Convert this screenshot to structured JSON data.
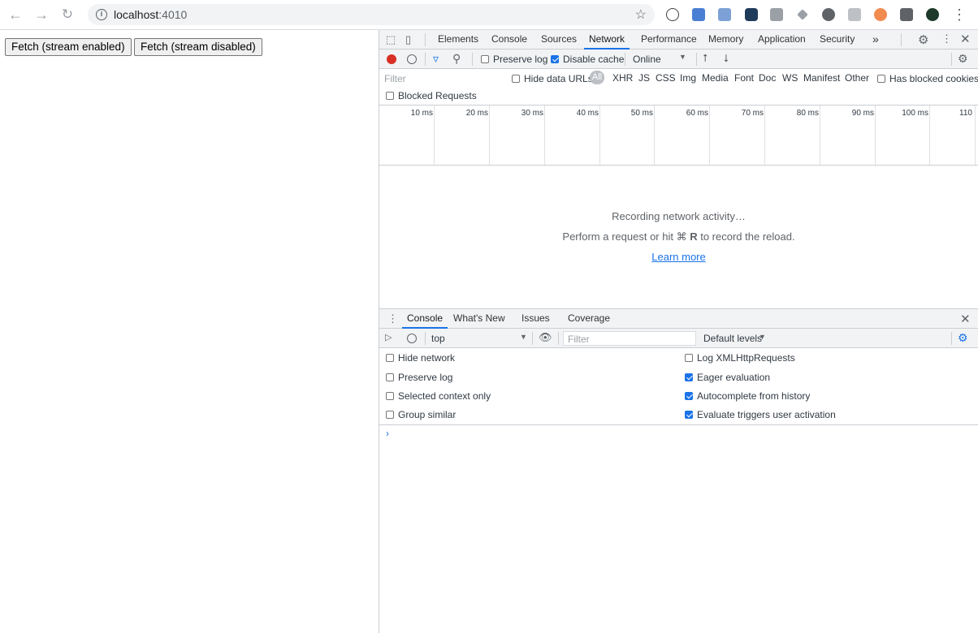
{
  "browser": {
    "url_host": "localhost",
    "url_port": ":4010"
  },
  "page": {
    "btn_stream_enabled": "Fetch (stream enabled)",
    "btn_stream_disabled": "Fetch (stream disabled)"
  },
  "devtools": {
    "tabs": [
      "Elements",
      "Console",
      "Sources",
      "Network",
      "Performance",
      "Memory",
      "Application",
      "Security"
    ],
    "active_tab": "Network",
    "more_tabs": "»",
    "network_toolbar": {
      "preserve_log": "Preserve log",
      "disable_cache": "Disable cache",
      "throttle": "Online"
    },
    "filter_bar": {
      "placeholder": "Filter",
      "hide_data_urls": "Hide data URLs",
      "types": [
        "All",
        "XHR",
        "JS",
        "CSS",
        "Img",
        "Media",
        "Font",
        "Doc",
        "WS",
        "Manifest",
        "Other"
      ],
      "has_blocked_cookies": "Has blocked cookies",
      "blocked_requests": "Blocked Requests"
    },
    "timeline_ticks": [
      "10 ms",
      "20 ms",
      "30 ms",
      "40 ms",
      "50 ms",
      "60 ms",
      "70 ms",
      "80 ms",
      "90 ms",
      "100 ms",
      "110"
    ],
    "empty_state": {
      "line1": "Recording network activity…",
      "line2_prefix": "Perform a request or hit ⌘",
      "line2_key": "R",
      "line2_suffix": "to record the reload.",
      "learn_more": "Learn more"
    },
    "drawer": {
      "tabs": [
        "Console",
        "What's New",
        "Issues",
        "Coverage"
      ],
      "active_tab": "Console",
      "context": "top",
      "filter_placeholder": "Filter",
      "levels": "Default levels",
      "settings_left": [
        {
          "label": "Hide network",
          "checked": false
        },
        {
          "label": "Preserve log",
          "checked": false
        },
        {
          "label": "Selected context only",
          "checked": false
        },
        {
          "label": "Group similar",
          "checked": false
        }
      ],
      "settings_right": [
        {
          "label": "Log XMLHttpRequests",
          "checked": false
        },
        {
          "label": "Eager evaluation",
          "checked": true
        },
        {
          "label": "Autocomplete from history",
          "checked": true
        },
        {
          "label": "Evaluate triggers user activation",
          "checked": true
        }
      ],
      "prompt": "›"
    },
    "colors": {
      "accent": "#1a73e8",
      "record": "#d93025"
    }
  }
}
